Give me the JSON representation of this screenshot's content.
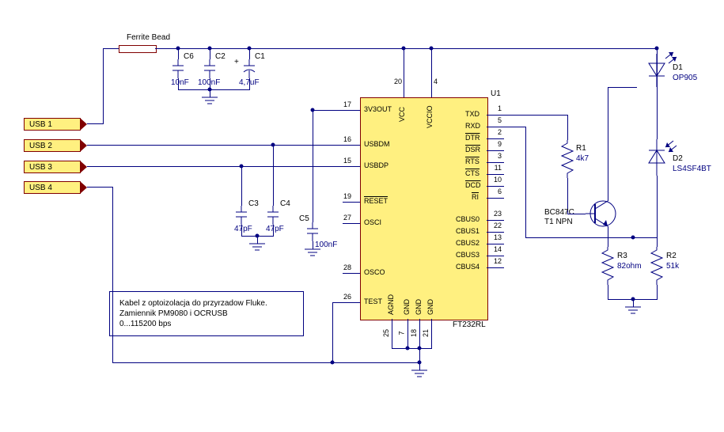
{
  "title": "Ferrite Bead",
  "ports": {
    "usb1": "USB 1",
    "usb2": "USB 2",
    "usb3": "USB 3",
    "usb4": "USB 4"
  },
  "caps": {
    "c1": {
      "ref": "C1",
      "val": "4,7uF",
      "pol": "+"
    },
    "c2": {
      "ref": "C2",
      "val": "100nF"
    },
    "c3": {
      "ref": "C3",
      "val": "47pF"
    },
    "c4": {
      "ref": "C4",
      "val": "47pF"
    },
    "c5": {
      "ref": "C5",
      "val": "100nF"
    },
    "c6": {
      "ref": "C6",
      "val": "10nF"
    }
  },
  "ic": {
    "ref": "U1",
    "part": "FT232RL",
    "left": [
      {
        "num": "17",
        "name": "3V3OUT"
      },
      {
        "num": "16",
        "name": "USBDM"
      },
      {
        "num": "15",
        "name": "USBDP"
      },
      {
        "num": "19",
        "name": "RESET",
        "over": true
      },
      {
        "num": "27",
        "name": "OSCI"
      },
      {
        "num": "28",
        "name": "OSCO"
      },
      {
        "num": "26",
        "name": "TEST"
      }
    ],
    "right": [
      {
        "num": "1",
        "name": "TXD"
      },
      {
        "num": "5",
        "name": "RXD"
      },
      {
        "num": "2",
        "name": "DTR",
        "over": true
      },
      {
        "num": "9",
        "name": "DSR",
        "over": true
      },
      {
        "num": "3",
        "name": "RTS",
        "over": true
      },
      {
        "num": "11",
        "name": "CTS",
        "over": true
      },
      {
        "num": "10",
        "name": "DCD",
        "over": true
      },
      {
        "num": "6",
        "name": "RI",
        "over": true
      },
      {
        "num": "23",
        "name": "CBUS0"
      },
      {
        "num": "22",
        "name": "CBUS1"
      },
      {
        "num": "13",
        "name": "CBUS2"
      },
      {
        "num": "14",
        "name": "CBUS3"
      },
      {
        "num": "12",
        "name": "CBUS4"
      }
    ],
    "top": [
      {
        "num": "20",
        "name": "VCC"
      },
      {
        "num": "4",
        "name": "VCCIO"
      }
    ],
    "bottom": [
      {
        "num": "25",
        "name": "AGND"
      },
      {
        "num": "7",
        "name": "GND"
      },
      {
        "num": "18",
        "name": "GND"
      },
      {
        "num": "21",
        "name": "GND"
      }
    ]
  },
  "res": {
    "r1": {
      "ref": "R1",
      "val": "4k7"
    },
    "r2": {
      "ref": "R2",
      "val": "51k"
    },
    "r3": {
      "ref": "R3",
      "val": "82ohm"
    }
  },
  "trans": {
    "ref": "T1 NPN",
    "part": "BC847C "
  },
  "diodes": {
    "d1": {
      "ref": "D1",
      "val": "OP905"
    },
    "d2": {
      "ref": "D2",
      "val": "LS4SF4BT"
    }
  },
  "note": {
    "l1": "Kabel z optoizolacja do przyrzadow Fluke.",
    "l2": "Zamiennik PM9080 i OCRUSB",
    "l3": "0...115200 bps"
  }
}
